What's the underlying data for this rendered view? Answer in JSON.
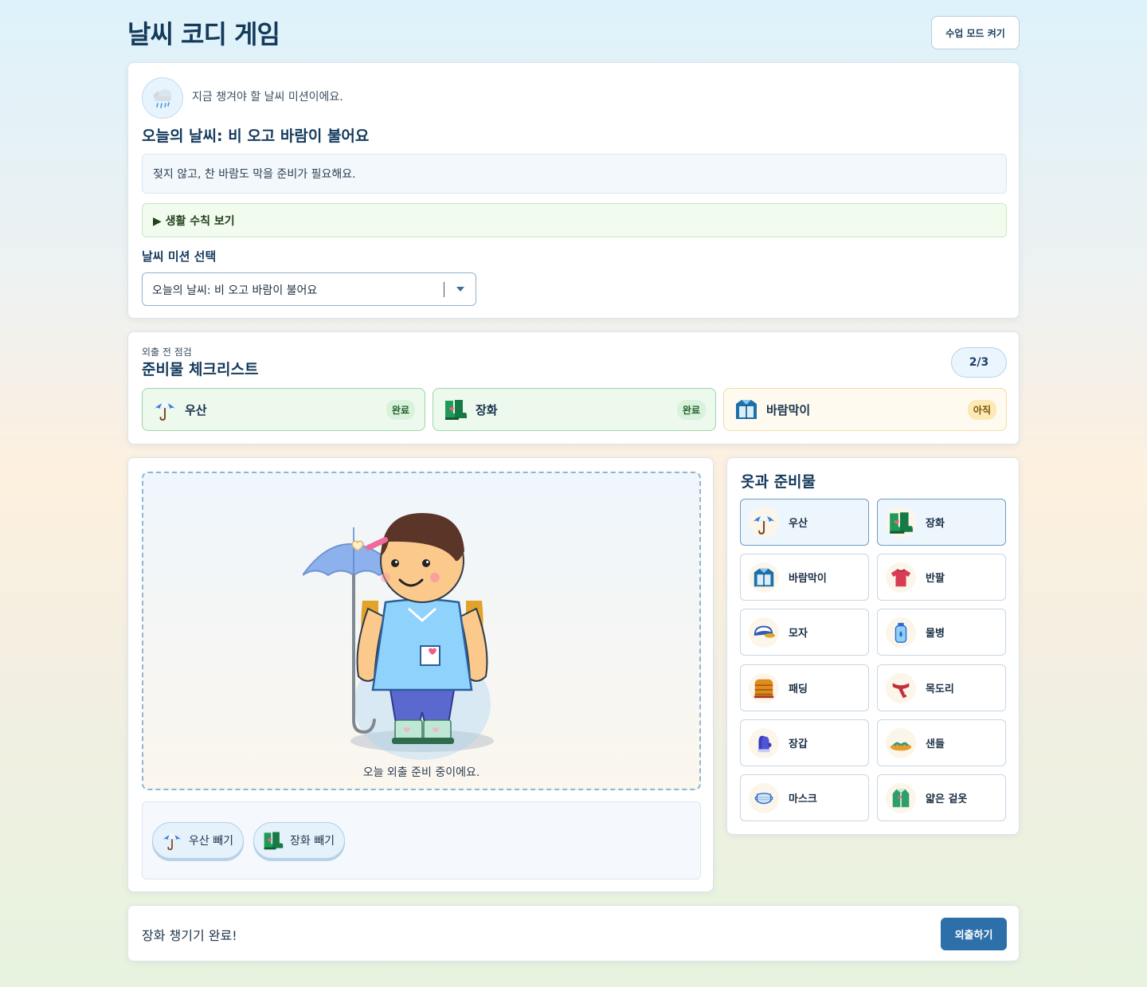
{
  "app": {
    "title": "날씨 코디 게임",
    "mode_button": "수업 모드 켜기"
  },
  "mission": {
    "intro": "지금 챙겨야 할 날씨 미션이에요.",
    "weather_icon": "rain-cloud-icon",
    "title": "오늘의 날씨: 비 오고 바람이 불어요",
    "description": "젖지 않고, 찬 바람도 막을 준비가 필요해요.",
    "rules_toggle": "▶ 생활 수칙 보기",
    "select_label": "날씨 미션 선택",
    "select_value": "오늘의 날씨: 비 오고 바람이 불어요"
  },
  "checklist": {
    "subtitle": "외출 전 점검",
    "title": "준비물 체크리스트",
    "count": "2/3",
    "items": [
      {
        "label": "우산",
        "status": "완료",
        "icon": "umbrella-icon"
      },
      {
        "label": "장화",
        "status": "완료",
        "icon": "rain-boots-icon"
      },
      {
        "label": "바람막이",
        "status": "아직",
        "icon": "windbreaker-icon"
      }
    ]
  },
  "stage": {
    "status": "오늘 외출 준비 중이에요.",
    "worn": [
      {
        "label": "우산 빼기",
        "icon": "umbrella-icon"
      },
      {
        "label": "장화 빼기",
        "icon": "rain-boots-icon"
      }
    ]
  },
  "wardrobe": {
    "title": "옷과 준비물",
    "items": [
      {
        "label": "우산",
        "icon": "umbrella-icon",
        "selected": true
      },
      {
        "label": "장화",
        "icon": "rain-boots-icon",
        "selected": true
      },
      {
        "label": "바람막이",
        "icon": "windbreaker-icon",
        "selected": false
      },
      {
        "label": "반팔",
        "icon": "tshirt-icon",
        "selected": false
      },
      {
        "label": "모자",
        "icon": "cap-icon",
        "selected": false
      },
      {
        "label": "물병",
        "icon": "water-bottle-icon",
        "selected": false
      },
      {
        "label": "패딩",
        "icon": "padded-jacket-icon",
        "selected": false
      },
      {
        "label": "목도리",
        "icon": "scarf-icon",
        "selected": false
      },
      {
        "label": "장갑",
        "icon": "gloves-icon",
        "selected": false
      },
      {
        "label": "샌들",
        "icon": "sandals-icon",
        "selected": false
      },
      {
        "label": "마스크",
        "icon": "mask-icon",
        "selected": false
      },
      {
        "label": "얇은 겉옷",
        "icon": "light-jacket-icon",
        "selected": false
      }
    ]
  },
  "footer": {
    "message": "장화 챙기기 완료!",
    "go_button": "외출하기"
  },
  "colors": {
    "primary": "#2d6fa8",
    "done": "#9bd6a4",
    "pending": "#f1dca5",
    "title": "#143a5c"
  }
}
